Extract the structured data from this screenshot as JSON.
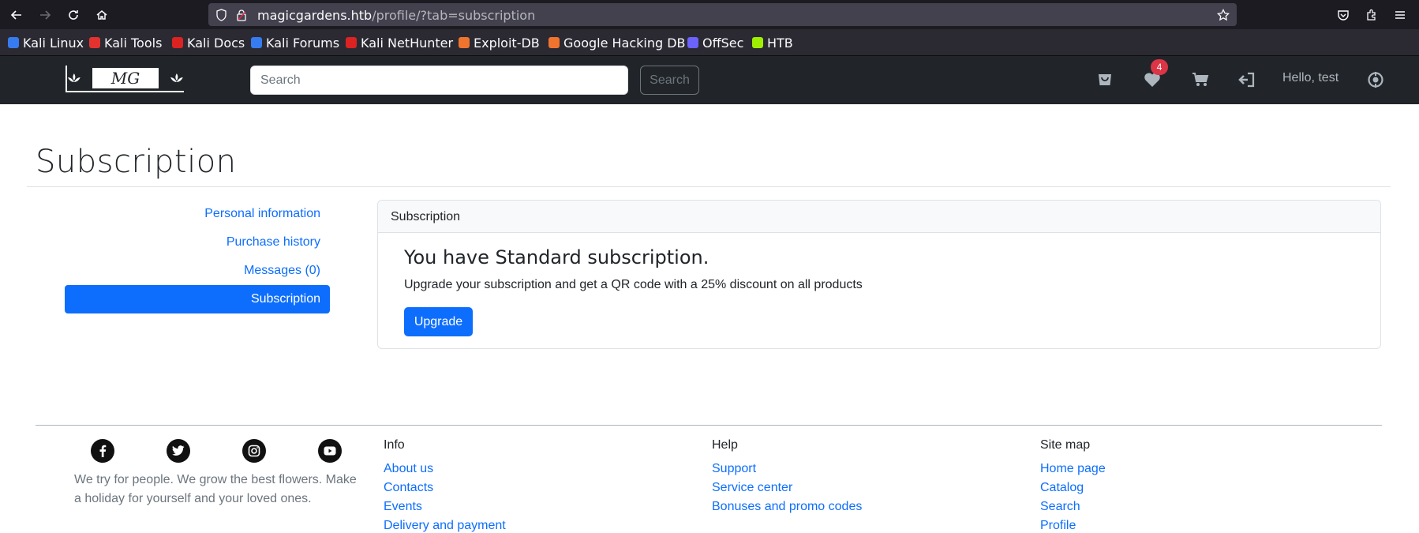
{
  "browser": {
    "url_domain": "magicgardens.htb",
    "url_path": "/profile/?tab=subscription",
    "bookmarks": [
      {
        "label": "Kali Linux",
        "color": "#367bf0"
      },
      {
        "label": "Kali Tools",
        "color": "#e6322e"
      },
      {
        "label": "Kali Docs",
        "color": "#d22"
      },
      {
        "label": "Kali Forums",
        "color": "#367bf0"
      },
      {
        "label": "Kali NetHunter",
        "color": "#d22"
      },
      {
        "label": "Exploit-DB",
        "color": "#f0742e"
      },
      {
        "label": "Google Hacking DB",
        "color": "#f0742e"
      },
      {
        "label": "OffSec",
        "color": "#6c63ff"
      },
      {
        "label": "HTB",
        "color": "#9fef00"
      }
    ]
  },
  "header": {
    "logo_text": "MG",
    "search_placeholder": "Search",
    "search_button": "Search",
    "wishlist_count": "4",
    "greeting": "Hello, test"
  },
  "page": {
    "title": "Subscription"
  },
  "sidebar": {
    "items": [
      {
        "label": "Personal information"
      },
      {
        "label": "Purchase history"
      },
      {
        "label": "Messages (0)"
      },
      {
        "label": "Subscription",
        "active": true
      }
    ]
  },
  "card": {
    "header": "Subscription",
    "heading": "You have Standard subscription.",
    "text": "Upgrade your subscription and get a QR code with a 25% discount on all products",
    "button": "Upgrade"
  },
  "footer": {
    "about": "We try for people. We grow the best flowers. Make a holiday for yourself and your loved ones.",
    "columns": [
      {
        "title": "Info",
        "links": [
          "About us",
          "Contacts",
          "Events",
          "Delivery and payment"
        ]
      },
      {
        "title": "Help",
        "links": [
          "Support",
          "Service center",
          "Bonuses and promo codes"
        ]
      },
      {
        "title": "Site map",
        "links": [
          "Home page",
          "Catalog",
          "Search",
          "Profile"
        ]
      }
    ]
  },
  "colors": {
    "primary": "#0d6efd",
    "navbar": "#212529",
    "badge": "#dc3545"
  }
}
